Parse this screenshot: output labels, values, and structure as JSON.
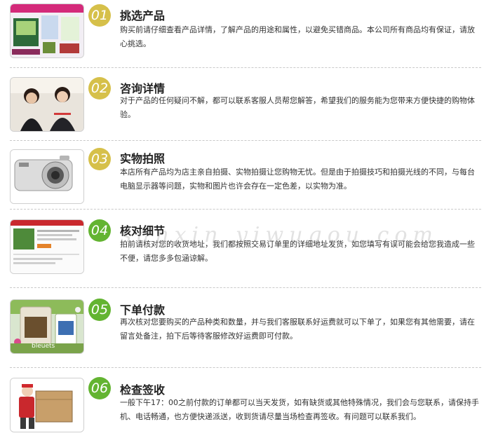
{
  "colors": {
    "badge_yellow": "#d6c04a",
    "badge_green": "#63b431"
  },
  "watermark": "sanxin yiwugou.com",
  "steps": [
    {
      "number": "01",
      "title": "挑选产品",
      "description": "购买前请仔细查看产品详情，了解产品的用途和属性，以避免买错商品。本公司所有商品均有保证，请放心挑选。",
      "image": "product-display-photo"
    },
    {
      "number": "02",
      "title": "咨询详情",
      "description": "对于产品的任何疑问不解，都可以联系客服人员帮您解答，希望我们的服务能为您带来方便快捷的购物体验。",
      "image": "customer-service-photo"
    },
    {
      "number": "03",
      "title": "实物拍照",
      "description": "本店所有产品均为店主亲自拍摄、实物拍摄让您购物无忧。但是由于拍摄技巧和拍摄光线的不同，与每台电脑显示器等问题，实物和图片也许会存在一定色差，以实物为准。",
      "image": "camera-photo"
    },
    {
      "number": "04",
      "title": "核对细节",
      "description": "拍前请核对您的收货地址，我们都按照交易订单里的详细地址发货，如您填写有误可能会给您我造成一些不便，请您多多包涵谅解。",
      "image": "order-page-screenshot"
    },
    {
      "number": "05",
      "title": "下单付款",
      "description": "再次核对您要购买的产品种类和数量，并与我们客服联系好运费就可以下单了，如果您有其他需要，请在留言处备注，拍下后等待客服修改好运费即可付款。",
      "image": "packaged-goods-photo",
      "image_caption": "bleuets"
    },
    {
      "number": "06",
      "title": "检查签收",
      "description": "一般下午17：00之前付款的订单都可以当天发货，如有缺货或其他特殊情况，我们会与您联系，请保持手机、电话畅通，也方便快递派送，收到货请尽量当场检查再签收。有问题可以联系我们。",
      "image": "courier-delivery-photo"
    }
  ]
}
